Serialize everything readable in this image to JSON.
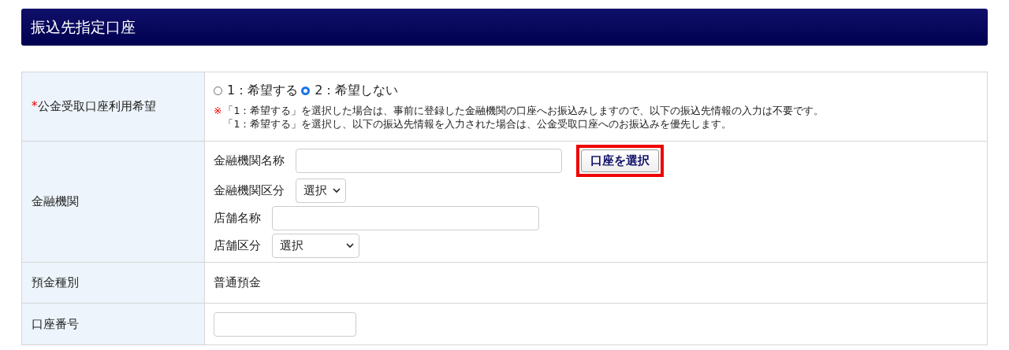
{
  "section_title": "振込先指定口座",
  "rows": [
    {
      "kind": "radio",
      "label": "公金受取口座利用希望",
      "required_mark": "*",
      "options": [
        {
          "label": "1：希望する",
          "selected": false
        },
        {
          "label": "2：希望しない",
          "selected": true
        }
      ],
      "note_mark": "※",
      "notes": [
        "「1：希望する」を選択した場合は、事前に登録した金融機関の口座へお振込みしますので、以下の振込先情報の入力は不要です。",
        "「1：希望する」を選択し、以下の振込先情報を入力された場合は、公金受取口座へのお振込みを優先します。"
      ]
    },
    {
      "kind": "bank",
      "label": "金融機関",
      "fields": [
        {
          "kind": "text",
          "label": "金融機関名称",
          "button": {
            "label": "口座を選択",
            "highlighted": true
          }
        },
        {
          "kind": "select",
          "label": "金融機関区分",
          "value": "選択"
        },
        {
          "kind": "text",
          "label": "店舗名称"
        },
        {
          "kind": "select",
          "label": "店舗区分",
          "value": "選択"
        }
      ]
    },
    {
      "kind": "static",
      "label": "預金種別",
      "value": "普通預金"
    },
    {
      "kind": "input",
      "label": "口座番号"
    }
  ]
}
